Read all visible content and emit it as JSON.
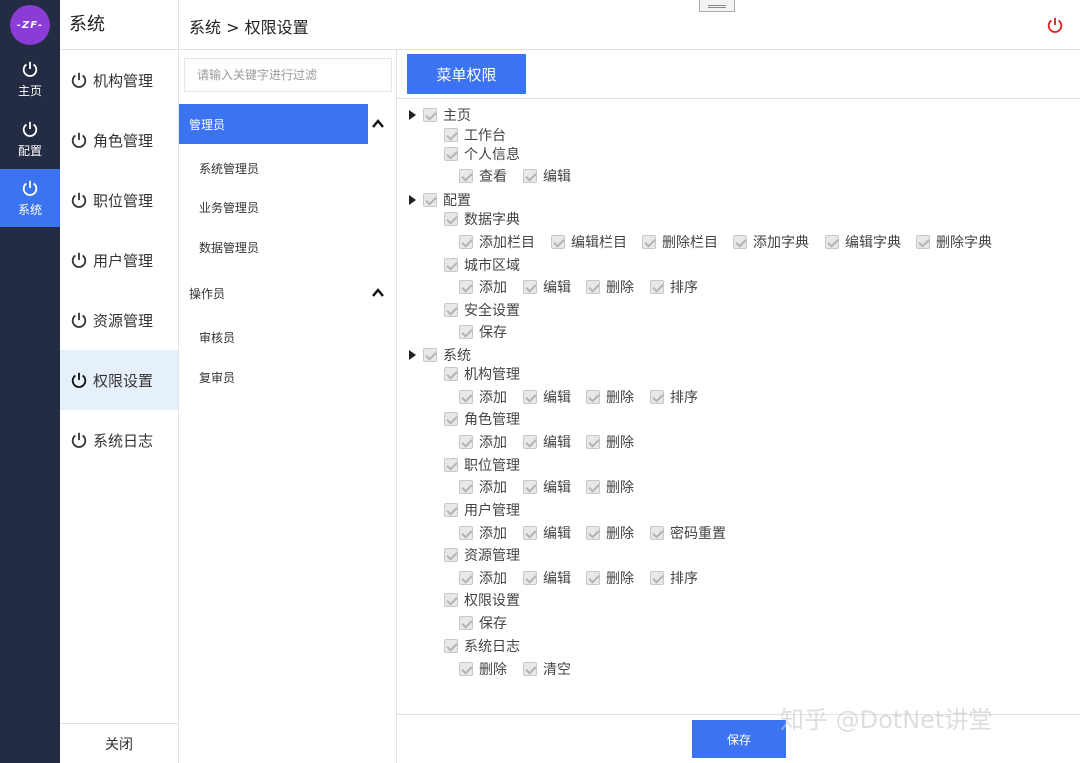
{
  "logo": {
    "text": "ZF"
  },
  "rail": [
    {
      "label": "主页",
      "icon": "power-icon"
    },
    {
      "label": "配置",
      "icon": "power-icon"
    },
    {
      "label": "系统",
      "icon": "power-icon",
      "active": true
    }
  ],
  "menu": {
    "title": "系统",
    "items": [
      "机构管理",
      "角色管理",
      "职位管理",
      "用户管理",
      "资源管理",
      "权限设置",
      "系统日志"
    ],
    "active": "权限设置",
    "footer": "关闭"
  },
  "header": {
    "breadcrumb": "系统 > 权限设置"
  },
  "roles": {
    "filter_placeholder": "请输入关键字进行过滤",
    "groups": [
      {
        "label": "管理员",
        "expanded": true,
        "active": true,
        "items": [
          "系统管理员",
          "业务管理员",
          "数据管理员"
        ]
      },
      {
        "label": "操作员",
        "expanded": true,
        "active": false,
        "items": [
          "审核员",
          "复审员"
        ]
      }
    ]
  },
  "main": {
    "tab": "菜单权限",
    "save": "保存",
    "tree": {
      "home": "主页",
      "home_workbench": "工作台",
      "home_profile": "个人信息",
      "home_profile_view": "查看",
      "home_profile_edit": "编辑",
      "config": "配置",
      "dict": "数据字典",
      "dict_add_col": "添加栏目",
      "dict_edit_col": "编辑栏目",
      "dict_del_col": "删除栏目",
      "dict_add": "添加字典",
      "dict_edit": "编辑字典",
      "dict_del": "删除字典",
      "city": "城市区域",
      "city_add": "添加",
      "city_edit": "编辑",
      "city_del": "删除",
      "city_sort": "排序",
      "security": "安全设置",
      "security_save": "保存",
      "system": "系统",
      "org": "机构管理",
      "org_add": "添加",
      "org_edit": "编辑",
      "org_del": "删除",
      "org_sort": "排序",
      "role": "角色管理",
      "role_add": "添加",
      "role_edit": "编辑",
      "role_del": "删除",
      "pos": "职位管理",
      "pos_add": "添加",
      "pos_edit": "编辑",
      "pos_del": "删除",
      "user": "用户管理",
      "user_add": "添加",
      "user_edit": "编辑",
      "user_del": "删除",
      "user_reset": "密码重置",
      "res": "资源管理",
      "res_add": "添加",
      "res_edit": "编辑",
      "res_del": "删除",
      "res_sort": "排序",
      "perm": "权限设置",
      "perm_save": "保存",
      "log": "系统日志",
      "log_del": "删除",
      "log_clear": "清空"
    }
  },
  "watermark": "知乎 @DotNet讲堂",
  "colors": {
    "accent": "#3c73f0",
    "rail": "#232c42",
    "logo": "#8b3bd6",
    "power_red": "#e02020"
  }
}
